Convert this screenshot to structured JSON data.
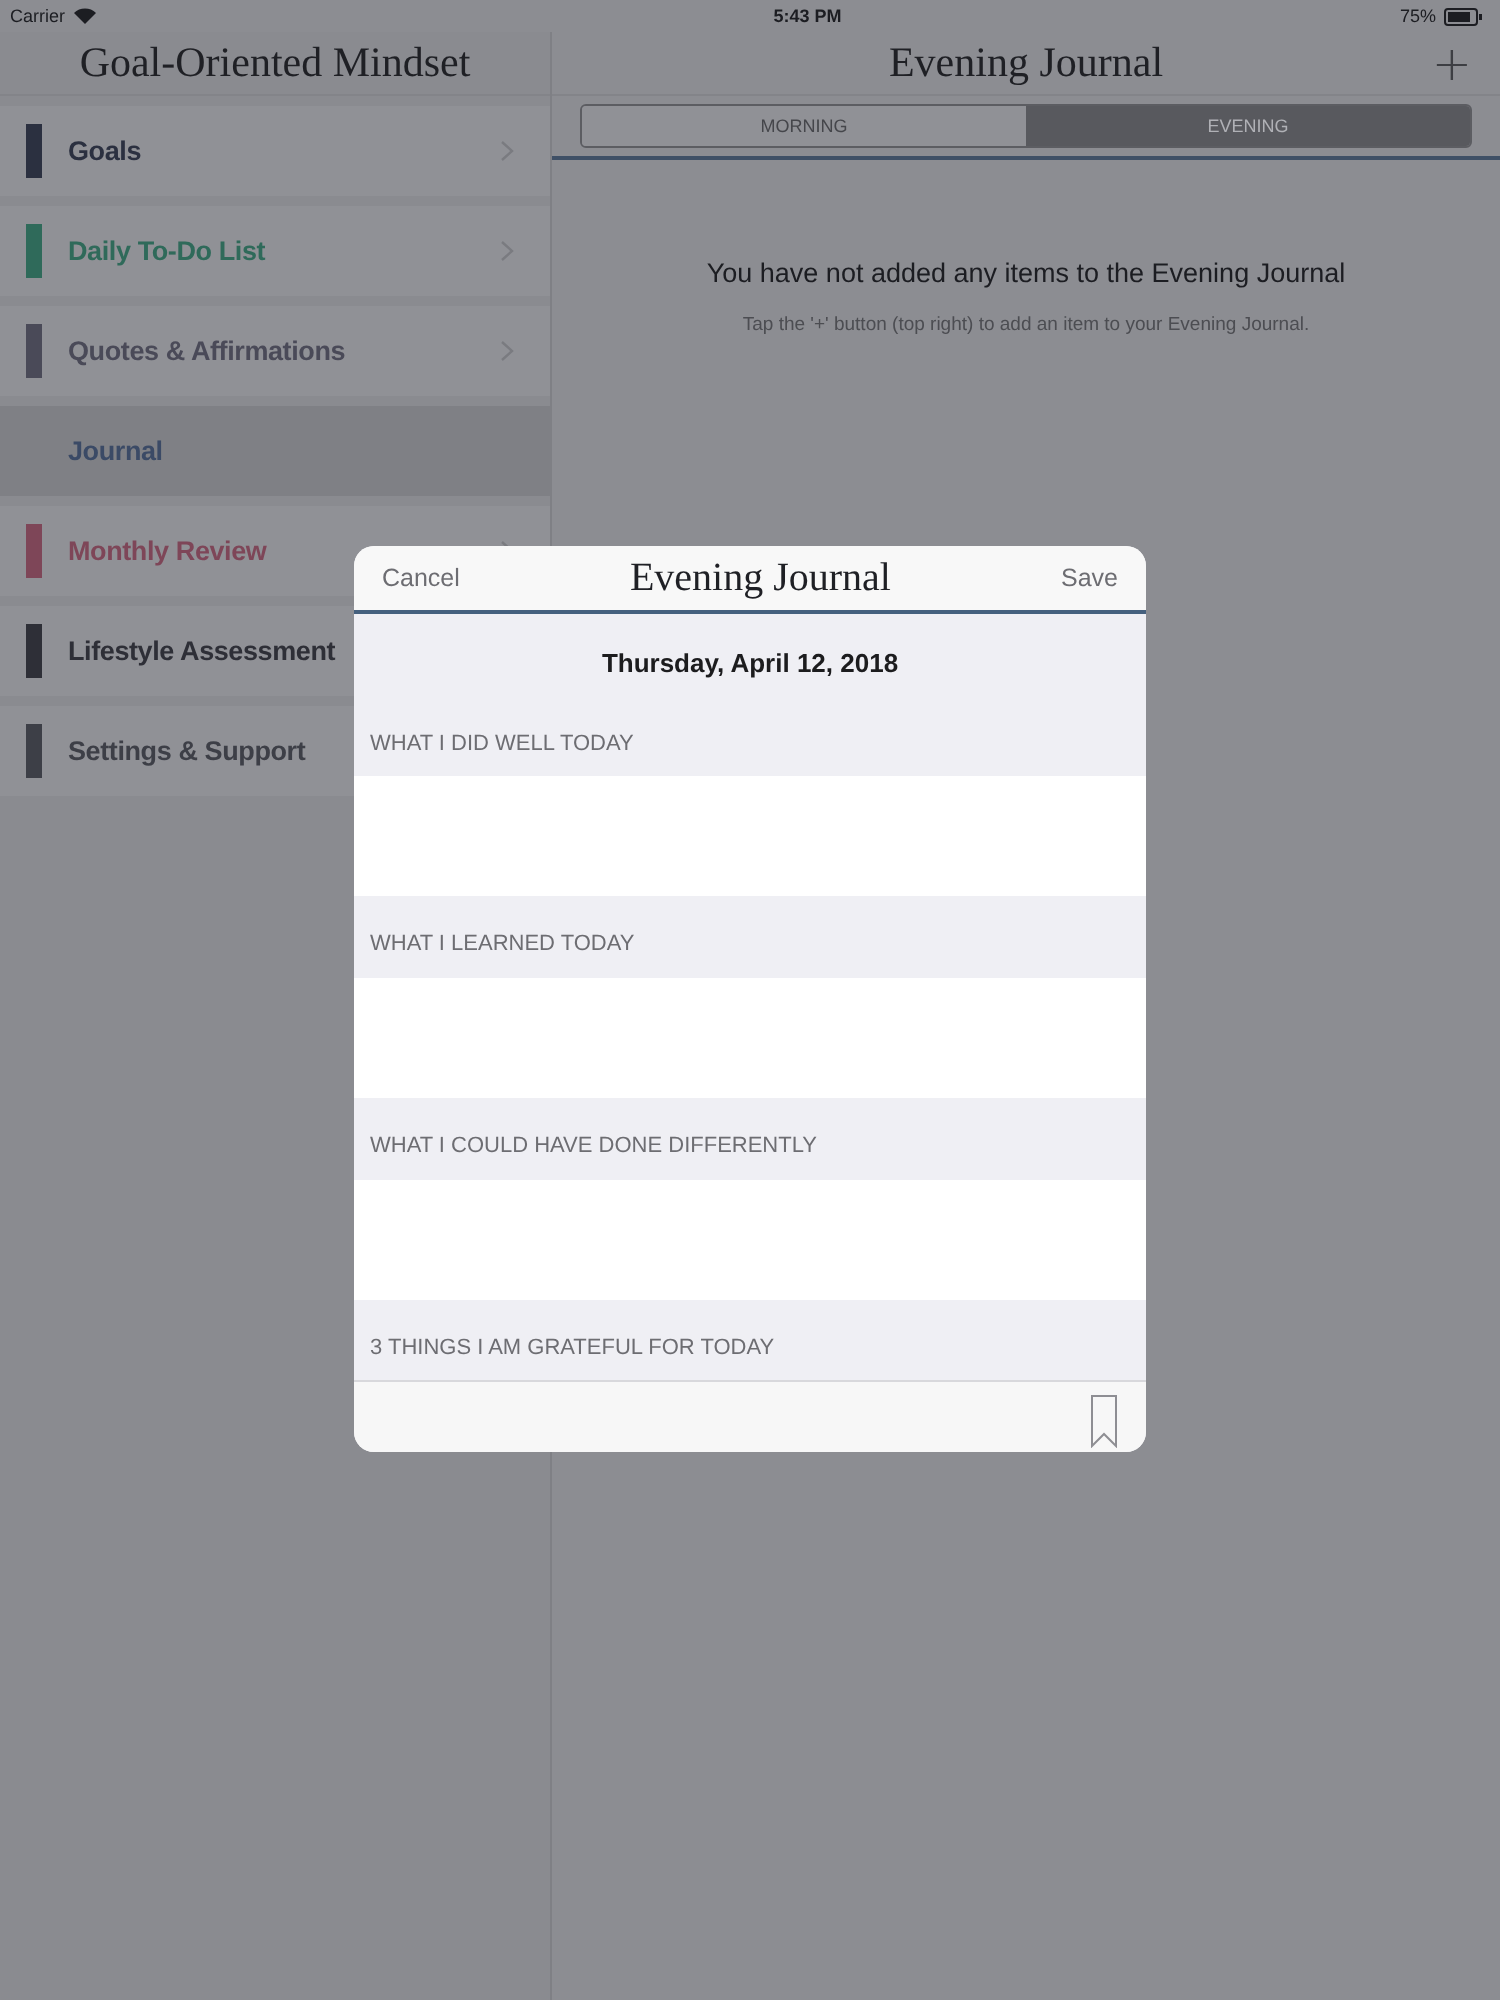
{
  "status_bar": {
    "carrier": "Carrier",
    "time": "5:43 PM",
    "battery": "75%"
  },
  "sidebar": {
    "title": "Goal-Oriented Mindset",
    "items": [
      {
        "label": "Goals",
        "color": "#2b3040",
        "selected": false,
        "chevron": true
      },
      {
        "label": "Daily To-Do List",
        "color": "#2f6a5a",
        "selected": false,
        "chevron": true
      },
      {
        "label": "Quotes & Affirmations",
        "color": "#4a4a58",
        "selected": false,
        "chevron": true
      },
      {
        "label": "Journal",
        "color": "#3b4a66",
        "selected": true,
        "chevron": false
      },
      {
        "label": "Monthly Review",
        "color": "#7e4658",
        "selected": false,
        "chevron": true
      },
      {
        "label": "Lifestyle Assessment",
        "color": "#2e2f37",
        "selected": false,
        "chevron": false
      },
      {
        "label": "Settings & Support",
        "color": "#3d3f47",
        "selected": false,
        "chevron": false
      }
    ]
  },
  "main": {
    "title": "Evening Journal",
    "add_button": "+",
    "segments": [
      {
        "label": "MORNING",
        "selected": false
      },
      {
        "label": "EVENING",
        "selected": true
      }
    ],
    "empty_title": "You have not added any items to the Evening Journal",
    "empty_hint": "Tap the '+' button (top right) to add an item to your Evening Journal."
  },
  "dialog": {
    "cancel": "Cancel",
    "title": "Evening Journal",
    "save": "Save",
    "date": "Thursday, April 12, 2018",
    "sections": [
      {
        "header": "WHAT I DID WELL TODAY",
        "kind": "field"
      },
      {
        "header": "WHAT I LEARNED TODAY",
        "kind": "field"
      },
      {
        "header": "WHAT I COULD HAVE DONE DIFFERENTLY",
        "kind": "field"
      },
      {
        "header": "3 THINGS I AM GRATEFUL FOR TODAY",
        "kind": "header"
      }
    ]
  }
}
